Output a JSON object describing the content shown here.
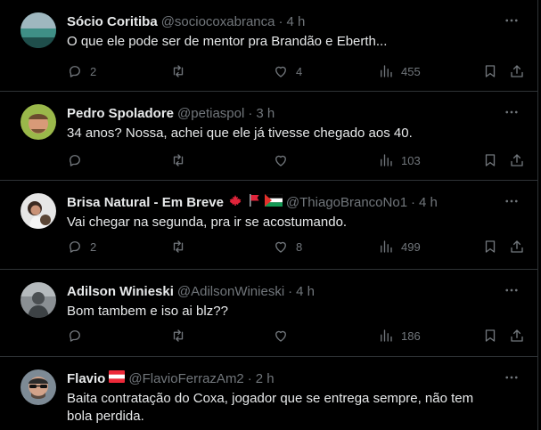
{
  "tweets": [
    {
      "name": "Sócio Coritiba",
      "handle": "@sociocoxabranca",
      "dot": "·",
      "time": "4 h",
      "text": "O que ele pode ser de mentor pra Brandão e Eberth...",
      "replies": "2",
      "retweets": "",
      "likes": "4",
      "views": "455"
    },
    {
      "name": "Pedro Spoladore",
      "handle": "@petiaspol",
      "dot": "·",
      "time": "3 h",
      "text": "34 anos? Nossa, achei que ele já tivesse chegado aos 40.",
      "replies": "",
      "retweets": "",
      "likes": "",
      "views": "103"
    },
    {
      "name": "Brisa Natural - Em Breve",
      "handle": "@ThiagoBrancoNo1",
      "dot": "·",
      "time": "4 h",
      "text": "Vai chegar na segunda, pra ir se acostumando.",
      "replies": "2",
      "retweets": "",
      "likes": "8",
      "views": "499"
    },
    {
      "name": "Adilson Winieski",
      "handle": "@AdilsonWinieski",
      "dot": "·",
      "time": "4 h",
      "text": "Bom tambem e iso ai blz??",
      "replies": "",
      "retweets": "",
      "likes": "",
      "views": "186"
    },
    {
      "name": "Flavio",
      "handle": "@FlavioFerrazAm2",
      "dot": "·",
      "time": "2 h",
      "text": "Baita contratação do Coxa, jogador que se entrega sempre, não tem bola perdida.",
      "replies": "",
      "retweets": "",
      "likes": "",
      "views": ""
    }
  ],
  "icons": {
    "more": "more-dots-icon",
    "reply": "reply-icon",
    "retweet": "retweet-icon",
    "like": "heart-icon",
    "views": "views-chart-icon",
    "bookmark": "bookmark-icon",
    "share": "share-icon",
    "flags": [
      "canada-flag-icon",
      "red-flag-icon",
      "palestine-flag-icon",
      "austria-flag-icon"
    ]
  },
  "colors": {
    "background": "#000000",
    "text": "#e7e9ea",
    "secondary": "#71767b",
    "border": "#2f3336"
  }
}
